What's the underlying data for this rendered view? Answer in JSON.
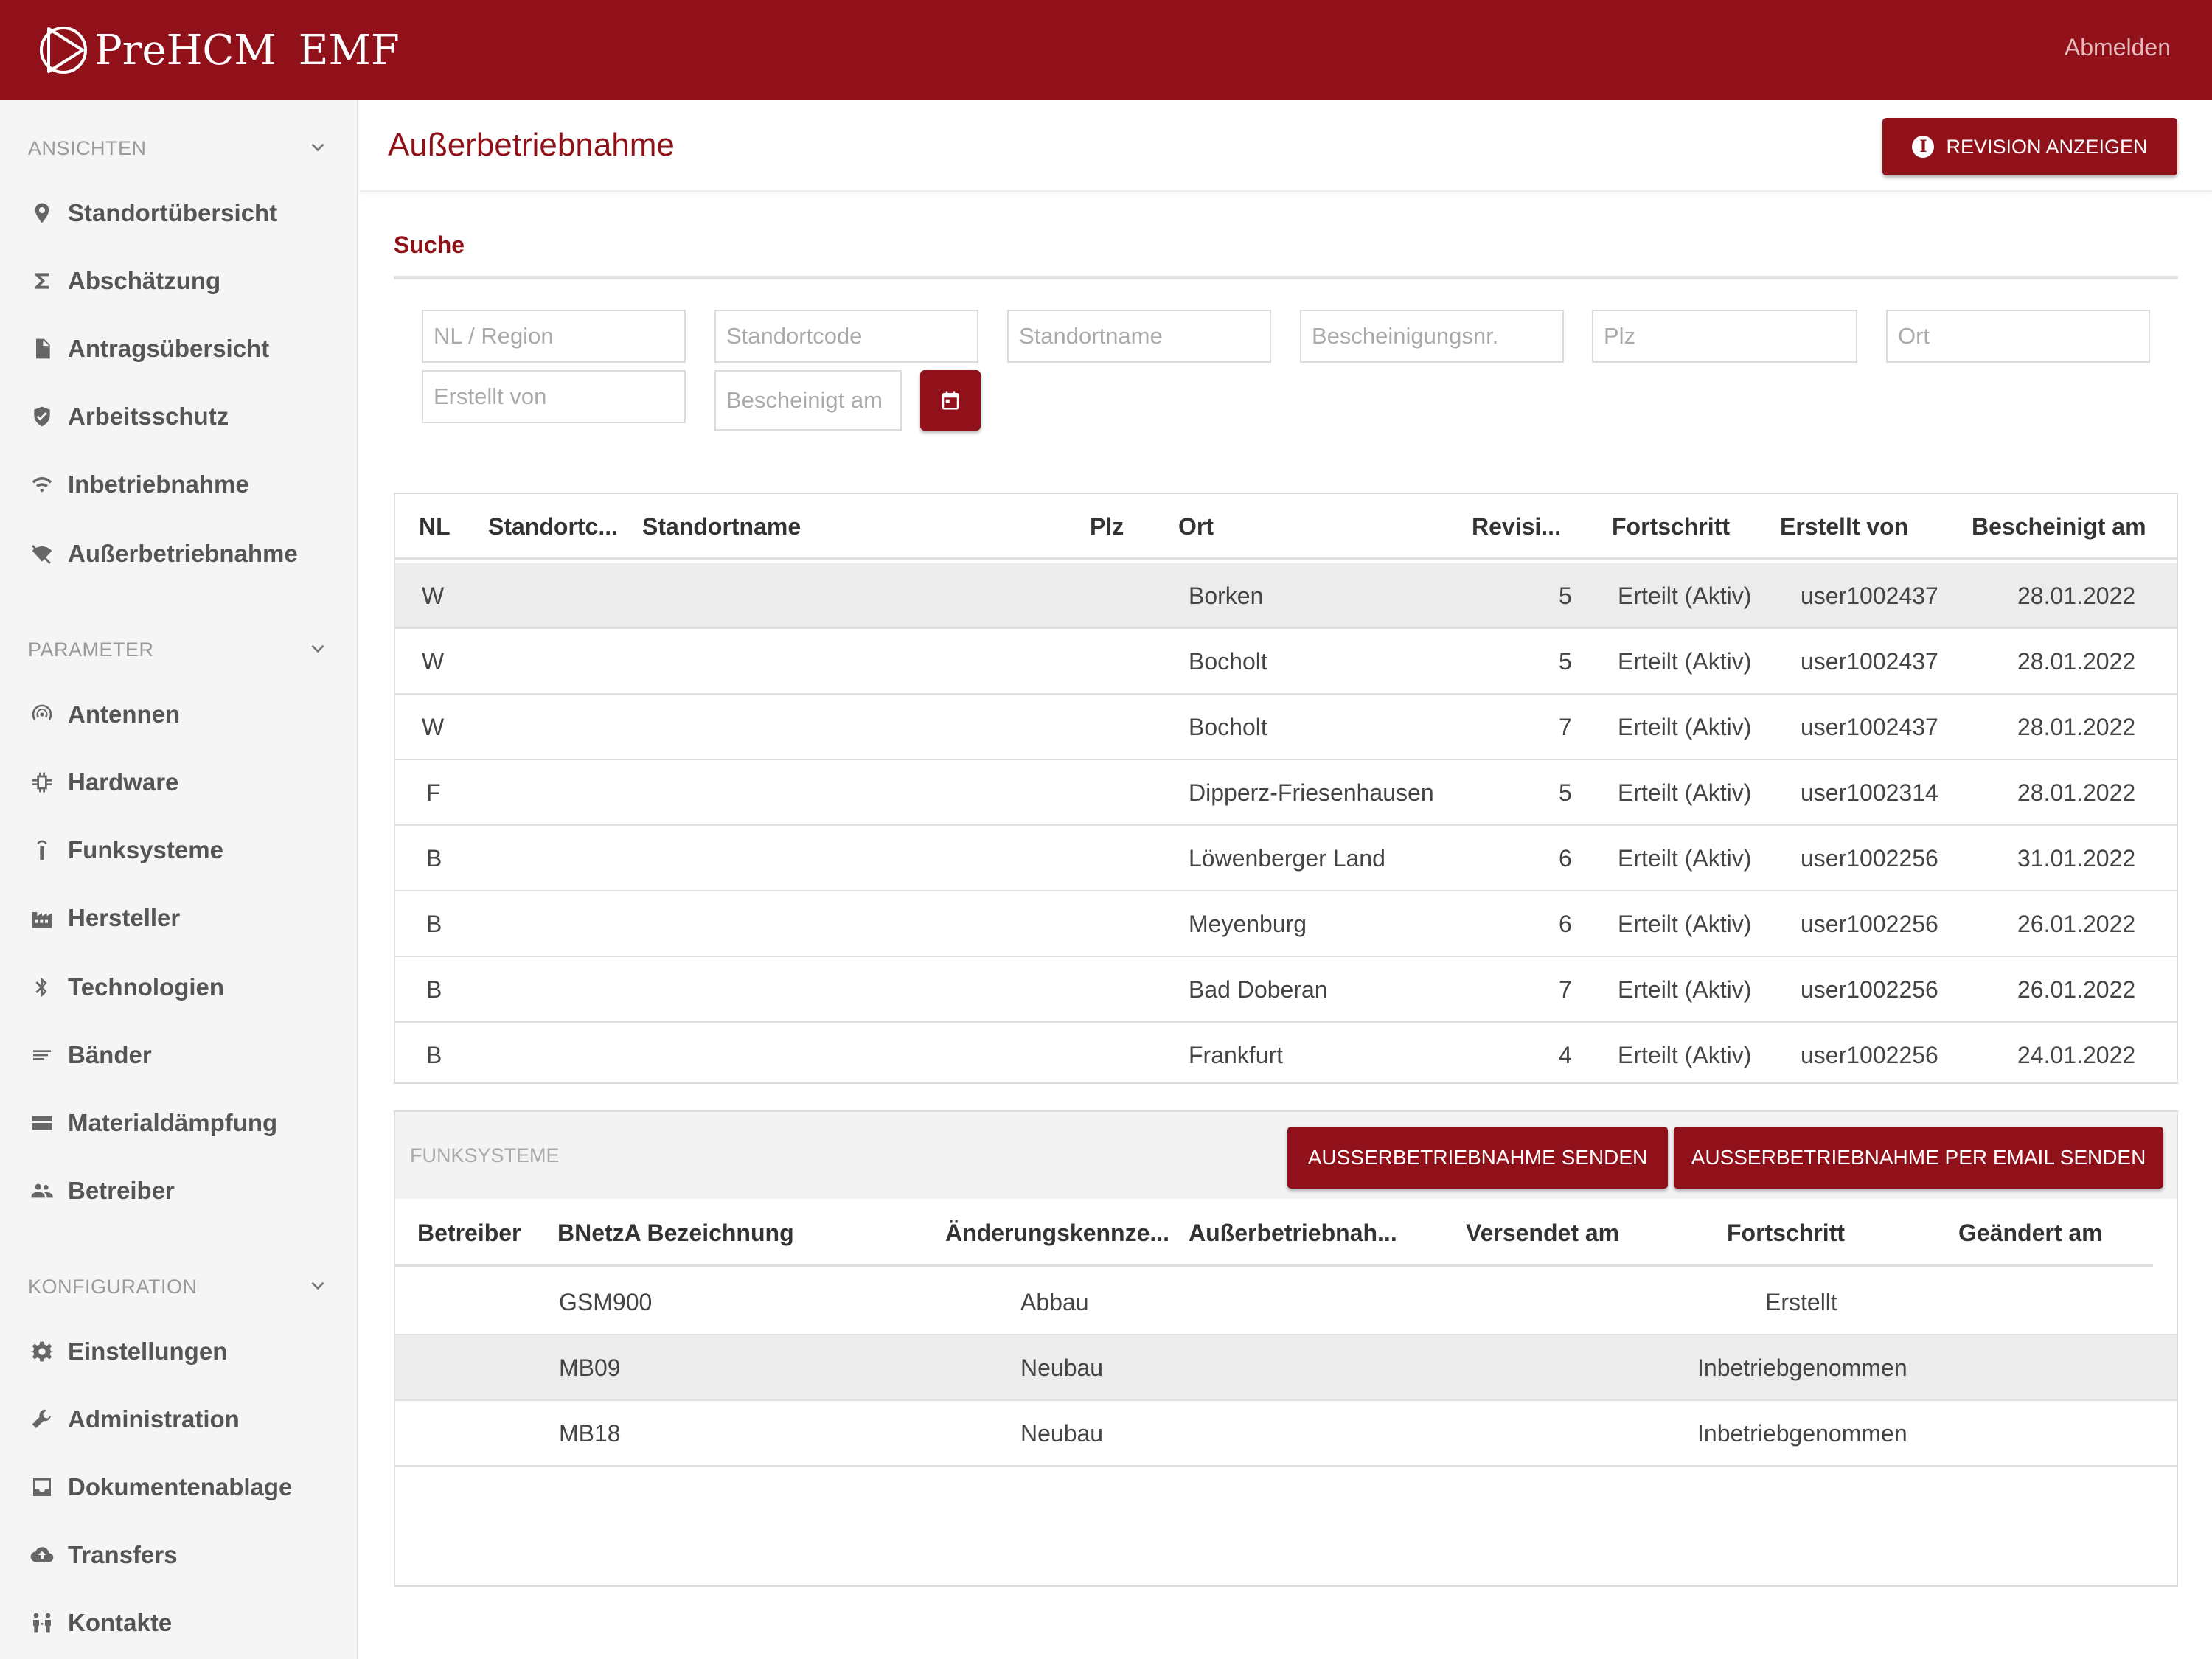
{
  "header": {
    "brand_name": "PreHCM",
    "brand_suffix": "EMF",
    "logout_label": "Abmelden"
  },
  "sidebar": {
    "sections": [
      {
        "label": "ANSICHTEN",
        "items": [
          {
            "label": "Standortübersicht",
            "icon": "map-pin-icon"
          },
          {
            "label": "Abschätzung",
            "icon": "sigma-icon"
          },
          {
            "label": "Antragsübersicht",
            "icon": "document-icon"
          },
          {
            "label": "Arbeitsschutz",
            "icon": "shield-check-icon"
          },
          {
            "label": "Inbetriebnahme",
            "icon": "wifi-icon"
          },
          {
            "label": "Außerbetriebnahme",
            "icon": "wifi-off-icon"
          }
        ]
      },
      {
        "label": "PARAMETER",
        "items": [
          {
            "label": "Antennen",
            "icon": "antenna-icon"
          },
          {
            "label": "Hardware",
            "icon": "chip-icon"
          },
          {
            "label": "Funksysteme",
            "icon": "radio-tower-icon"
          },
          {
            "label": "Hersteller",
            "icon": "factory-icon"
          },
          {
            "label": "Technologien",
            "icon": "bluetooth-icon"
          },
          {
            "label": "Bänder",
            "icon": "lines-icon"
          },
          {
            "label": "Materialdämpfung",
            "icon": "wall-icon"
          },
          {
            "label": "Betreiber",
            "icon": "people-icon"
          }
        ]
      },
      {
        "label": "KONFIGURATION",
        "items": [
          {
            "label": "Einstellungen",
            "icon": "gear-icon"
          },
          {
            "label": "Administration",
            "icon": "wrench-icon"
          },
          {
            "label": "Dokumentenablage",
            "icon": "inbox-icon"
          },
          {
            "label": "Transfers",
            "icon": "cloud-upload-icon"
          },
          {
            "label": "Kontakte",
            "icon": "contacts-icon"
          }
        ]
      }
    ]
  },
  "page": {
    "title": "Außerbetriebnahme",
    "revision_button": "REVISION ANZEIGEN"
  },
  "search": {
    "title": "Suche",
    "fields": {
      "nl_region": "NL / Region",
      "standortcode": "Standortcode",
      "standortname": "Standortname",
      "bescheinigungsnr": "Bescheinigungsnr.",
      "plz": "Plz",
      "ort": "Ort",
      "erstellt_von": "Erstellt von",
      "bescheinigt_am": "Bescheinigt am"
    }
  },
  "sites_table": {
    "columns": [
      "NL",
      "Standortc...",
      "Standortname",
      "Plz",
      "Ort",
      "Revisi...",
      "Fortschritt",
      "Erstellt von",
      "Bescheinigt am"
    ],
    "rows": [
      {
        "nl": "W",
        "ort": "Borken",
        "rev": "5",
        "fortschritt": "Erteilt (Aktiv)",
        "user": "user1002437",
        "date": "28.01.2022"
      },
      {
        "nl": "W",
        "ort": "Bocholt",
        "rev": "5",
        "fortschritt": "Erteilt (Aktiv)",
        "user": "user1002437",
        "date": "28.01.2022"
      },
      {
        "nl": "W",
        "ort": "Bocholt",
        "rev": "7",
        "fortschritt": "Erteilt (Aktiv)",
        "user": "user1002437",
        "date": "28.01.2022"
      },
      {
        "nl": "F",
        "ort": "Dipperz-Friesenhausen",
        "rev": "5",
        "fortschritt": "Erteilt (Aktiv)",
        "user": "user1002314",
        "date": "28.01.2022"
      },
      {
        "nl": "B",
        "ort": "Löwenberger Land",
        "rev": "6",
        "fortschritt": "Erteilt (Aktiv)",
        "user": "user1002256",
        "date": "31.01.2022"
      },
      {
        "nl": "B",
        "ort": "Meyenburg",
        "rev": "6",
        "fortschritt": "Erteilt (Aktiv)",
        "user": "user1002256",
        "date": "26.01.2022"
      },
      {
        "nl": "B",
        "ort": "Bad Doberan",
        "rev": "7",
        "fortschritt": "Erteilt (Aktiv)",
        "user": "user1002256",
        "date": "26.01.2022"
      },
      {
        "nl": "B",
        "ort": "Frankfurt",
        "rev": "4",
        "fortschritt": "Erteilt (Aktiv)",
        "user": "user1002256",
        "date": "24.01.2022"
      }
    ]
  },
  "funksysteme": {
    "label": "FUNKSYSTEME",
    "send_button": "AUSSERBETRIEBNAHME SENDEN",
    "send_email_button": "AUSSERBETRIEBNAHME PER EMAIL SENDEN",
    "columns": [
      "Betreiber",
      "BNetzA Bezeichnung",
      "Änderungskennze...",
      "Außerbetriebnah...",
      "Versendet am",
      "Fortschritt",
      "Geändert am"
    ],
    "rows": [
      {
        "bezeichnung": "GSM900",
        "aenderung": "Abbau",
        "fortschritt": "Erstellt"
      },
      {
        "bezeichnung": "MB09",
        "aenderung": "Neubau",
        "fortschritt": "Inbetriebgenommen"
      },
      {
        "bezeichnung": "MB18",
        "aenderung": "Neubau",
        "fortschritt": "Inbetriebgenommen"
      }
    ]
  },
  "colors": {
    "brand": "#91111b",
    "selected_row": "#ececec"
  }
}
